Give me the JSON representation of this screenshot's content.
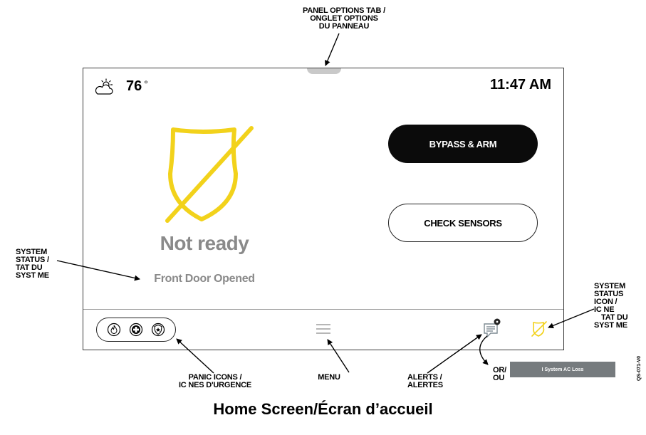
{
  "callouts": {
    "panel_tab": [
      "PANEL OPTIONS TAB /",
      "ONGLET OPTIONS",
      "DU PANNEAU"
    ],
    "system_status": [
      "SYSTEM",
      "STATUS /",
      "TAT DU",
      "SYST  ME"
    ],
    "system_status_icon": [
      "SYSTEM",
      "STATUS",
      "ICON /",
      "IC  NE",
      "TAT DU",
      "SYST  ME"
    ],
    "panic_icons": [
      "PANIC ICONS /",
      "IC  NES D'URGENCE"
    ],
    "menu": "MENU",
    "alerts": [
      "ALERTS /",
      "ALERTES"
    ],
    "or": [
      "OR/",
      "OU"
    ]
  },
  "screen": {
    "temperature": "76",
    "degree": "°",
    "time": "11:47 AM",
    "status": "Not ready",
    "status_detail": "Front Door Opened",
    "buttons": {
      "bypass_arm": "BYPASS & ARM",
      "check_sensors": "CHECK SENSORS"
    },
    "icons": {
      "weather": "partly-cloudy-icon",
      "shield": "shield-slash-icon",
      "fire": "fire-icon",
      "medical": "medical-cross-icon",
      "police": "police-badge-icon",
      "menu": "hamburger-menu-icon",
      "alerts": "alert-message-icon",
      "status_small": "shield-slash-small-icon"
    },
    "colors": {
      "status_yellow": "#f2d21b",
      "status_text_gray": "#8a8a8a",
      "primary_button": "#0b0b0b"
    }
  },
  "ac_loss_banner": "I System AC Loss",
  "doc_code": "QS-071-V0",
  "caption": "Home Screen/Écran d’accueil"
}
